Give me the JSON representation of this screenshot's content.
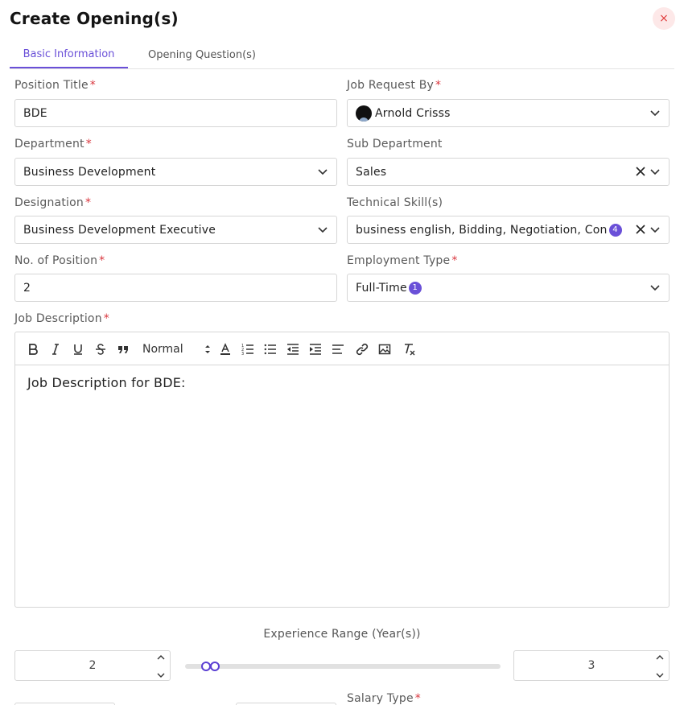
{
  "modal": {
    "title": "Create Opening(s)",
    "close_label": "×"
  },
  "tabs": [
    {
      "label": "Basic Information",
      "active": true
    },
    {
      "label": "Opening Question(s)",
      "active": false
    }
  ],
  "form": {
    "position_title": {
      "label": "Position Title",
      "required": "*",
      "value": "BDE"
    },
    "job_request_by": {
      "label": "Job Request By",
      "required": "*",
      "value": "Arnold Crisss"
    },
    "department": {
      "label": "Department",
      "required": "*",
      "value": "Business Development"
    },
    "sub_department": {
      "label": "Sub Department",
      "value": "Sales"
    },
    "designation": {
      "label": "Designation",
      "required": "*",
      "value": "Business Development Executive"
    },
    "technical_skills": {
      "label": "Technical Skill(s)",
      "value": "business english, Bidding, Negotiation, Con",
      "badge": "4"
    },
    "no_of_position": {
      "label": "No. of Position",
      "required": "*",
      "value": "2"
    },
    "employment_type": {
      "label": "Employment Type",
      "required": "*",
      "value": "Full-Time",
      "badge": "1"
    },
    "job_description": {
      "label": "Job Description",
      "required": "*",
      "toolbar": {
        "heading_select": "Normal"
      },
      "content": "Job Description for BDE:"
    },
    "experience": {
      "label": "Experience Range (Year(s))",
      "min": "2",
      "max": "3",
      "slider_low_fraction": 0.06,
      "slider_high_fraction": 0.09
    },
    "salary_type": {
      "label": "Salary Type",
      "required": "*"
    }
  },
  "colors": {
    "accent": "#6a50d8",
    "required": "#d9363e",
    "close_bg": "#fde8e8",
    "close_fg": "#e03a3a"
  }
}
